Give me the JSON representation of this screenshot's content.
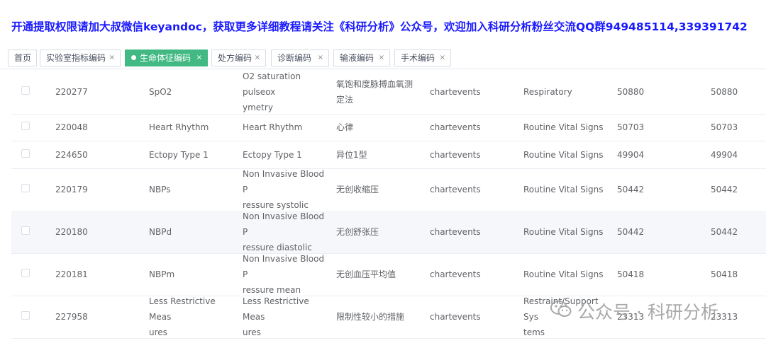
{
  "banner": "开通提取权限请加大叔微信keyandoc，获取更多详细教程请关注《科研分析》公众号，欢迎加入科研分析粉丝交流QQ群949485114,339391742",
  "tabs": [
    {
      "label": "首页",
      "closable": false,
      "active": false
    },
    {
      "label": "实验室指标编码",
      "closable": true,
      "active": false
    },
    {
      "label": "生命体征编码",
      "closable": true,
      "active": true
    },
    {
      "label": "处方编码",
      "closable": true,
      "active": false
    },
    {
      "label": "诊断编码",
      "closable": true,
      "active": false
    },
    {
      "label": "输液编码",
      "closable": true,
      "active": false
    },
    {
      "label": "手术编码",
      "closable": true,
      "active": false
    }
  ],
  "tab_close_glyph": "×",
  "accent_color": "#42b983",
  "rows": [
    {
      "id": "220277",
      "label": "SpO2",
      "name": [
        "O2 saturation pulseox",
        "ymetry"
      ],
      "cn": [
        "氧饱和度脉搏血氧测",
        "定法"
      ],
      "table": "chartevents",
      "category": [
        "Respiratory"
      ],
      "c1": "50880",
      "c2": "50880"
    },
    {
      "id": "220048",
      "label": "Heart Rhythm",
      "name": [
        "Heart Rhythm"
      ],
      "cn": [
        "心律"
      ],
      "table": "chartevents",
      "category": [
        "Routine Vital Signs"
      ],
      "c1": "50703",
      "c2": "50703"
    },
    {
      "id": "224650",
      "label": "Ectopy Type 1",
      "name": [
        "Ectopy Type 1"
      ],
      "cn": [
        "异位1型"
      ],
      "table": "chartevents",
      "category": [
        "Routine Vital Signs"
      ],
      "c1": "49904",
      "c2": "49904"
    },
    {
      "id": "220179",
      "label": "NBPs",
      "name": [
        "Non Invasive Blood P",
        "ressure systolic"
      ],
      "cn": [
        "无创收缩压"
      ],
      "table": "chartevents",
      "category": [
        "Routine Vital Signs"
      ],
      "c1": "50442",
      "c2": "50442"
    },
    {
      "id": "220180",
      "label": "NBPd",
      "name": [
        "Non Invasive Blood P",
        "ressure diastolic"
      ],
      "cn": [
        "无创舒张压"
      ],
      "table": "chartevents",
      "category": [
        "Routine Vital Signs"
      ],
      "c1": "50442",
      "c2": "50442"
    },
    {
      "id": "220181",
      "label": "NBPm",
      "name": [
        "Non Invasive Blood P",
        "ressure mean"
      ],
      "cn": [
        "无创血压平均值"
      ],
      "table": "chartevents",
      "category": [
        "Routine Vital Signs"
      ],
      "c1": "50418",
      "c2": "50418"
    },
    {
      "id": "227958",
      "label": [
        "Less Restrictive Meas",
        "ures"
      ],
      "name": [
        "Less Restrictive Meas",
        "ures"
      ],
      "cn": [
        "限制性较小的措施"
      ],
      "table": "chartevents",
      "category": [
        "Restraint/Support Sys",
        "tems"
      ],
      "c1": "23313",
      "c2": "23313"
    }
  ],
  "watermark": {
    "text": "公众号 · 科研分析",
    "icon": "wechat-icon"
  }
}
